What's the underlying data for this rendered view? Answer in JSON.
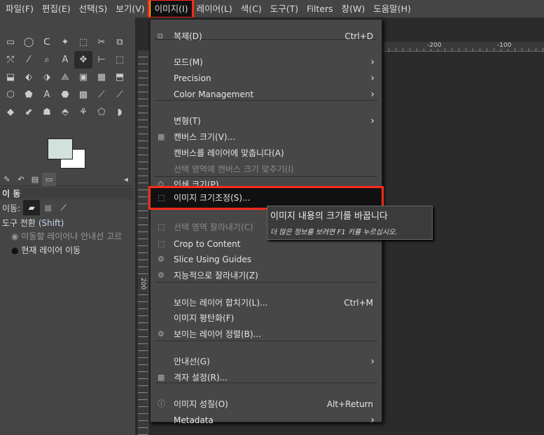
{
  "menubar": [
    "파일(F)",
    "편집(E)",
    "선택(S)",
    "보기(V)",
    "이미지(I)",
    "레이어(L)",
    "색(C)",
    "도구(T)",
    "Filters",
    "창(W)",
    "도움말(H)"
  ],
  "toolbox": {
    "panel_title": "이 동",
    "move_label": "이동:",
    "tool_toggle": "도구 전환",
    "shift": "(Shift)",
    "radio1": "이동할 레이어나 안내선 고르",
    "radio2": "현재 레이어 이동",
    "fg_color": "#d2e1dc",
    "bg_color": "#ffffff"
  },
  "ruler": {
    "top": [
      "-200",
      "-100"
    ],
    "left": [
      "200"
    ]
  },
  "menu": {
    "items": [
      {
        "label": "복제(D)",
        "shortcut": "Ctrl+D",
        "icon": "duplicate-icon"
      },
      {
        "label": "모드(M)",
        "submenu": true
      },
      {
        "label": "Precision",
        "submenu": true
      },
      {
        "label": "Color Management",
        "submenu": true
      },
      {
        "label": "변형(T)",
        "submenu": true
      },
      {
        "label": "캔버스 크기(V)...",
        "icon": "canvas-size-icon"
      },
      {
        "label": "캔버스를 레이어에 맞춥니다(A)"
      },
      {
        "label": "선택 영역에 캔버스 크기 맞추기(I)",
        "disabled": true
      },
      {
        "label": "인쇄 크기(P)...",
        "icon": "print-icon"
      },
      {
        "label": "이미지 크기조정(S)...",
        "icon": "scale-image-icon",
        "highlighted": true
      },
      {
        "label": "선택 영역 잘라내기(C)",
        "disabled": true,
        "icon": "crop-icon"
      },
      {
        "label": "Crop to Content",
        "icon": "crop-icon"
      },
      {
        "label": "Slice Using Guides",
        "icon": "gear-icon"
      },
      {
        "label": "지능적으로 잘라내기(Z)",
        "icon": "gear-icon"
      },
      {
        "label": "보이는 레이어 합치기(L)...",
        "shortcut": "Ctrl+M"
      },
      {
        "label": "이미지 평탄화(F)"
      },
      {
        "label": "보이는 레이어 정렬(B)...",
        "icon": "gear-icon"
      },
      {
        "label": "안내선(G)",
        "submenu": true
      },
      {
        "label": "격자 설정(R)...",
        "icon": "grid-icon"
      },
      {
        "label": "이미지 성질(O)",
        "shortcut": "Alt+Return",
        "icon": "info-icon"
      },
      {
        "label": "Metadata",
        "submenu": true
      }
    ]
  },
  "tooltip": {
    "title": "이미지 내용의 크기를 바꿉니다",
    "hint": "더 많은 정보를 보려면 F1 키를 누르십시오."
  }
}
